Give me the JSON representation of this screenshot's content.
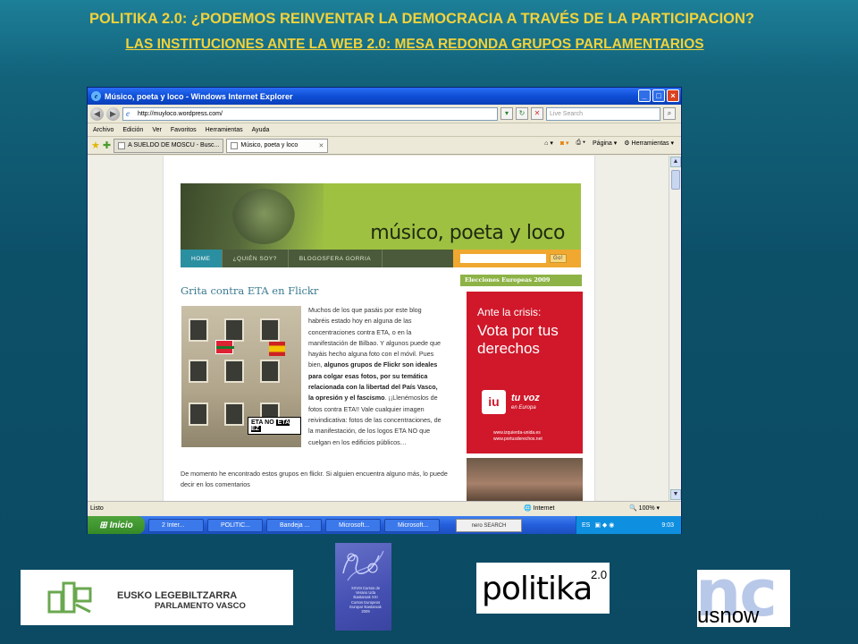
{
  "slide": {
    "title_line1": "POLITIKA 2.0: ¿PODEMOS REINVENTAR LA DEMOCRACIA A TRAVÉS DE LA PARTICIPACION?",
    "title_line2": "LAS INSTITUCIONES ANTE LA WEB 2.0: MESA REDONDA GRUPOS PARLAMENTARIOS"
  },
  "browser": {
    "window_title": "Músico, poeta y loco - Windows Internet Explorer",
    "address": "http://muyloco.wordpress.com/",
    "search_placeholder": "Live Search",
    "menu": [
      "Archivo",
      "Edición",
      "Ver",
      "Favoritos",
      "Herramientas",
      "Ayuda"
    ],
    "tabs": [
      "A SUELDO DE MOSCU - Busc...",
      "Músico, poeta y loco"
    ],
    "commands": [
      "Página",
      "Herramientas"
    ],
    "status": "Listo",
    "zone": "Internet",
    "zoom": "100%"
  },
  "blog": {
    "logo_text": "músico, poeta y loco",
    "nav": [
      "HOME",
      "¿QUIÉN SOY?",
      "BLOGOSFERA GORRIA"
    ],
    "search_button": "Go!",
    "post_title": "Grita contra ETA en Flickr",
    "image_sign_a": "ETA NO",
    "image_sign_b": "ETA EZ",
    "post_text_1": "Muchos de los que pasáis por este blog habréis estado hoy en alguna de las concentraciones contra ETA, o en la manifestación de Bilbao. Y algunos puede que hayáis hecho alguna foto con el móvil. Pues bien,",
    "post_text_bold": "algunos grupos de Flickr son ideales para colgar esas fotos, por su temática relacionada con la libertad del País Vasco, la opresión y el fascismo",
    "post_text_2": ". ¡¡Llenémoslos de fotos contra ETA!! Vale cualquier imagen reivindicativa: fotos de las concentraciones, de la manifestación, de los logos ETA NO que cuelgan en los edificios públicos…",
    "post_more": "De momento he encontrado estos grupos en flickr. Si alguien encuentra alguno más, lo puede decir en los comentarios",
    "sidebar_heading": "Elecciones Europeas 2009",
    "ad_line1": "Ante la crisis:",
    "ad_line2": "Vota por tus derechos",
    "ad_logo": "iu",
    "ad_slogan": "tu voz",
    "ad_slogan2": "en Europa",
    "ad_url1": "www.izquierda-unida.es",
    "ad_url2": "www.portusderechos.net"
  },
  "taskbar": {
    "start": "Inicio",
    "buttons": [
      "2 Inter...",
      "POLITIC...",
      "Bandeja ...",
      "Microsoft...",
      "Microsoft..."
    ],
    "nero": "nero SEARCH",
    "lang": "ES",
    "clock": "9:03"
  },
  "footer": {
    "eusko_line1": "EUSKO LEGEBILTZARRA",
    "eusko_line2": "PARLAMENTO VASCO",
    "book_text": "XXVIII Cursos de Verano Uda Ikastaroak XXI Cursos Europeos Europar Ikastaroak 2009",
    "politika": "politika",
    "politika_sup": "2.0",
    "nc": "nc",
    "usnow": "usnow"
  },
  "colors": {
    "title_yellow": "#f2d23a",
    "blog_green": "#9fc142",
    "ad_red": "#d0182a",
    "xp_blue": "#245edb"
  }
}
